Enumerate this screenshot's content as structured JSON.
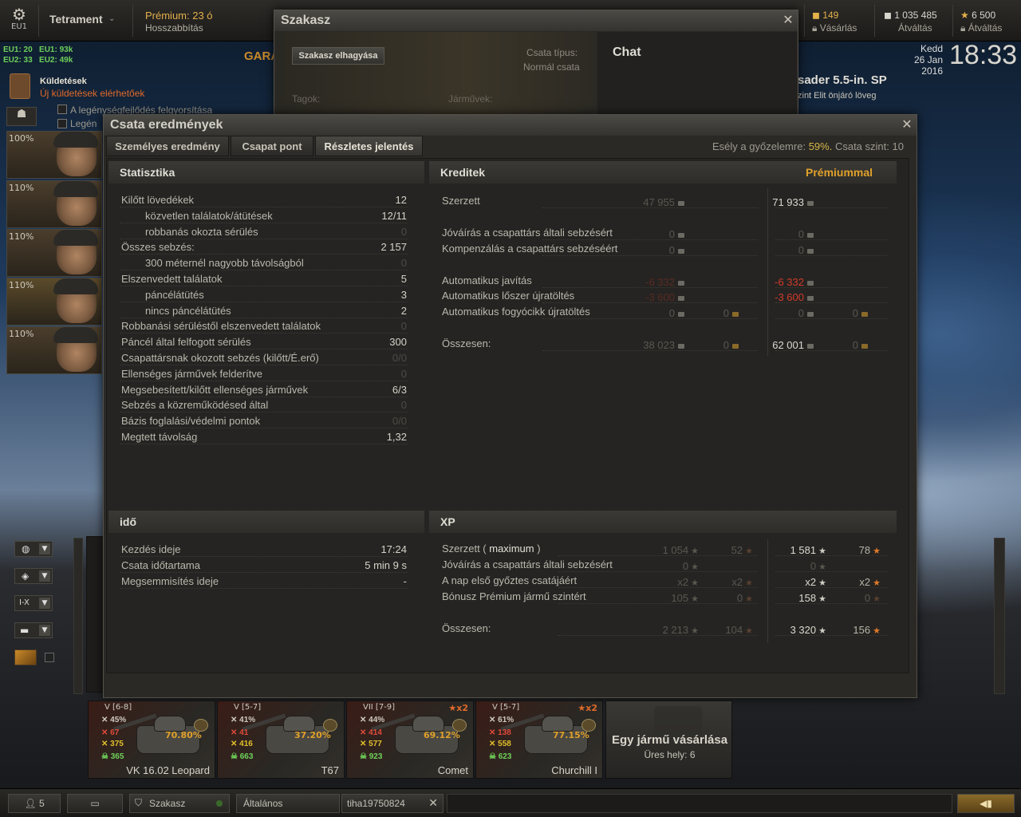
{
  "topbar": {
    "server": "EU1",
    "player": "Tetrament",
    "premium": "Prémium: 23 ó",
    "premium_extend": "Hosszabbítás",
    "gold": "149",
    "gold_action": "Vásárlás",
    "credits": "1 035 485",
    "credits_action": "Átváltás",
    "freexp": "6 500",
    "freexp_action": "Átváltás",
    "day": "Kedd",
    "date": "26 Jan 2016",
    "time": "18:33"
  },
  "servers": {
    "eu1_players": "EU1: 20",
    "eu2_players": "EU2: 33",
    "eu1_total": "EU1: 93k",
    "eu2_total": "EU2: 49k"
  },
  "garage_label": "GARA",
  "missions": {
    "title": "Küldetések",
    "subtitle": "Új küldetések elérhetőek",
    "checkbox1": "A legénységfejlődés felgyorsítása",
    "checkbox2": "Legén"
  },
  "crew": [
    {
      "pct": "100%"
    },
    {
      "pct": "110%"
    },
    {
      "pct": "110%"
    },
    {
      "pct": "110%"
    },
    {
      "pct": "110%"
    }
  ],
  "vehicle_header": {
    "name": "sader 5.5-in. SP",
    "desc": "zint Elit önjáró löveg"
  },
  "platoon": {
    "title": "Szakasz",
    "leave_button": "Szakasz elhagyása",
    "battle_type_label": "Csata típus:",
    "battle_type_value": "Normál csata",
    "chat": "Chat",
    "members_label": "Tagok:",
    "vehicles_label": "Járművek:"
  },
  "results": {
    "title": "Csata eredmények",
    "tabs": [
      "Személyes eredmény",
      "Csapat pont",
      "Részletes jelentés"
    ],
    "win_chance_label": "Esély a győzelemre:",
    "win_chance_value": "59%.",
    "battle_level": "Csata szint: 10",
    "stats": {
      "header": "Statisztika",
      "rows": [
        {
          "label": "Kilőtt lövedékek",
          "value": "12"
        },
        {
          "label": "közvetlen találatok/átütések",
          "value": "12/11"
        },
        {
          "label": "robbanás okozta sérülés",
          "value": "0"
        },
        {
          "label": "Összes sebzés:",
          "value": "2 157"
        },
        {
          "label": "300 méternél nagyobb távolságból",
          "value": "0"
        },
        {
          "label": "Elszenvedett találatok",
          "value": "5"
        },
        {
          "label": "páncélátütés",
          "value": "3"
        },
        {
          "label": "nincs páncélátütés",
          "value": "2"
        },
        {
          "label": "Robbanási sérüléstől elszenvedett találatok",
          "value": "0"
        },
        {
          "label": "Páncél által felfogott sérülés",
          "value": "300"
        },
        {
          "label": "Csapattársnak okozott sebzés (kilőtt/É.erő)",
          "value": "0/0"
        },
        {
          "label": "Ellenséges járművek felderítve",
          "value": "0"
        },
        {
          "label": "Megsebesített/kilőtt ellenséges járművek",
          "value": "6/3"
        },
        {
          "label": "Sebzés a közreműködésed által",
          "value": "0"
        },
        {
          "label": "Bázis foglalási/védelmi pontok",
          "value": "0/0"
        },
        {
          "label": "Megtett távolság",
          "value": "1,32"
        }
      ]
    },
    "credits": {
      "header": "Kreditek",
      "premium_header": "Prémiummal",
      "rows": [
        {
          "label": "Szerzett",
          "base": "47 955",
          "base_gold": "",
          "prem": "71 933",
          "prem_gold": ""
        },
        {
          "label": "Jóváírás a csapattárs általi sebzésért",
          "base": "0",
          "base_gold": "",
          "prem": "0",
          "prem_gold": ""
        },
        {
          "label": "Kompenzálás a csapattárs sebzéséért",
          "base": "0",
          "base_gold": "",
          "prem": "0",
          "prem_gold": ""
        },
        {
          "label": "Automatikus javítás",
          "base": "-6 332",
          "base_gold": "",
          "prem": "-6 332",
          "prem_gold": ""
        },
        {
          "label": "Automatikus lőszer újratöltés",
          "base": "-3 600",
          "base_gold": "",
          "prem": "-3 600",
          "prem_gold": ""
        },
        {
          "label": "Automatikus fogyócikk újratöltés",
          "base": "0",
          "base_gold": "0",
          "prem": "0",
          "prem_gold": "0"
        },
        {
          "label": "Összesen:",
          "base": "38 023",
          "base_gold": "0",
          "prem": "62 001",
          "prem_gold": "0"
        }
      ]
    },
    "time": {
      "header": "idő",
      "rows": [
        {
          "label": "Kezdés ideje",
          "value": "17:24"
        },
        {
          "label": "Csata időtartama",
          "value": "5 min 9 s"
        },
        {
          "label": "Megsemmisítés ideje",
          "value": "-"
        }
      ]
    },
    "xp": {
      "header": "XP",
      "earned_label": "Szerzett (",
      "earned_max": "maximum",
      "earned_close": ")",
      "rows": [
        {
          "label": "",
          "base": "1 054",
          "base_free": "52",
          "prem": "1 581",
          "prem_free": "78"
        },
        {
          "label": "Jóváírás a csapattárs általi sebzésért",
          "base": "0",
          "base_free": "",
          "prem": "0",
          "prem_free": ""
        },
        {
          "label": "A nap első győztes csatájáért",
          "base": "x2",
          "base_free": "x2",
          "prem": "x2",
          "prem_free": "x2"
        },
        {
          "label": "Bónusz Prémium jármű szintért",
          "base": "105",
          "base_free": "0",
          "prem": "158",
          "prem_free": "0"
        },
        {
          "label": "Összesen:",
          "base": "2 213",
          "base_free": "104",
          "prem": "3 320",
          "prem_free": "156"
        }
      ]
    }
  },
  "tanks": [
    {
      "tier": "V  [6-8]",
      "win": "45%",
      "dmg": "67",
      "hp": "375",
      "kills": "365",
      "mastery_pct": "70.80%",
      "name": "VK 16.02 Leopard",
      "x2": ""
    },
    {
      "tier": "V  [5-7]",
      "win": "41%",
      "dmg": "41",
      "hp": "416",
      "kills": "663",
      "mastery_pct": "37.20%",
      "name": "T67",
      "x2": ""
    },
    {
      "tier": "VII  [7-9]",
      "win": "44%",
      "dmg": "414",
      "hp": "577",
      "kills": "923",
      "mastery_pct": "69.12%",
      "name": "Comet",
      "x2": "x2"
    },
    {
      "tier": "V  [5-7]",
      "win": "61%",
      "dmg": "138",
      "hp": "558",
      "kills": "623",
      "mastery_pct": "77.15%",
      "name": "Churchill I",
      "x2": "x2"
    }
  ],
  "buy_slot": {
    "title": "Egy jármű vásárlása",
    "subtitle": "Üres hely: 6"
  },
  "filters": [
    "I-X"
  ],
  "bottombar": {
    "friends_count": "5",
    "platoon_channel": "Szakasz",
    "general_channel": "Általános",
    "player_channel": "tiha19750824"
  },
  "colors": {
    "gold": "#e3b04b",
    "win_chance": "#d6b847",
    "negative": "#d23a2a",
    "premium_header": "#e0a12a"
  }
}
